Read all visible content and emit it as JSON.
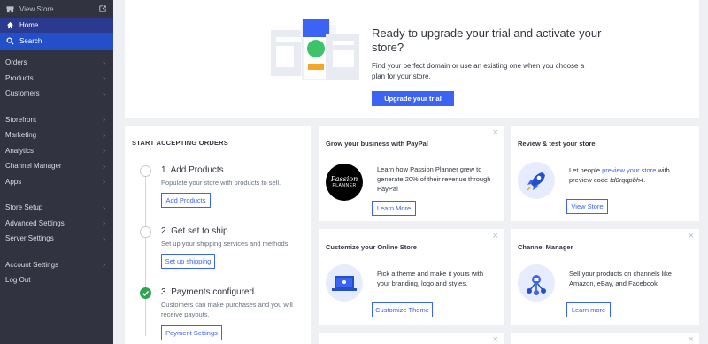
{
  "sidebar": {
    "view_store": "View Store",
    "home": "Home",
    "search": "Search",
    "groups": [
      [
        "Orders",
        "Products",
        "Customers"
      ],
      [
        "Storefront",
        "Marketing",
        "Analytics",
        "Channel Manager",
        "Apps"
      ],
      [
        "Store Setup",
        "Advanced Settings",
        "Server Settings"
      ],
      [
        "Account Settings",
        "Log Out"
      ]
    ],
    "chevron": "›"
  },
  "banner": {
    "title": "Ready to upgrade your trial and activate your store?",
    "text": "Find your perfect domain or use an existing one when you choose a plan for your store.",
    "button": "Upgrade your trial"
  },
  "orders": {
    "title": "START ACCEPTING ORDERS",
    "steps": [
      {
        "title": "1. Add Products",
        "desc": "Populate your store with products to sell.",
        "button": "Add Products",
        "done": false
      },
      {
        "title": "2. Get set to ship",
        "desc": "Set up your shipping services and methods.",
        "button": "Set up shipping",
        "done": false
      },
      {
        "title": "3. Payments configured",
        "desc": "Customers can make purchases and you will receive payouts.",
        "button": "Payment Settings",
        "done": true
      }
    ]
  },
  "cards": {
    "paypal": {
      "title": "Grow your business with PayPal",
      "text": "Learn how Passion Planner grew to generate 20% of their revenue through PayPal",
      "button": "Learn More",
      "logo_line1": "Passion",
      "logo_line2": "PLANNER"
    },
    "review": {
      "title": "Review & test your store",
      "text_before": "Let people ",
      "link": "preview your store",
      "text_mid": " with preview code ",
      "code": "td0rqqpbh4",
      "text_after": ".",
      "button": "View Store"
    },
    "customize": {
      "title": "Customize your Online Store",
      "text": "Pick a theme and make it yours with your branding, logo and styles.",
      "button": "Customize Theme"
    },
    "channel": {
      "title": "Channel Manager",
      "text": "Sell your products on channels like Amazon, eBay, and Facebook",
      "button": "Learn more"
    },
    "close": "×"
  },
  "colors": {
    "accent": "#3c64f4",
    "sidebar": "#313440",
    "success": "#2fa552",
    "icon_circle": "#e6ebfd"
  }
}
